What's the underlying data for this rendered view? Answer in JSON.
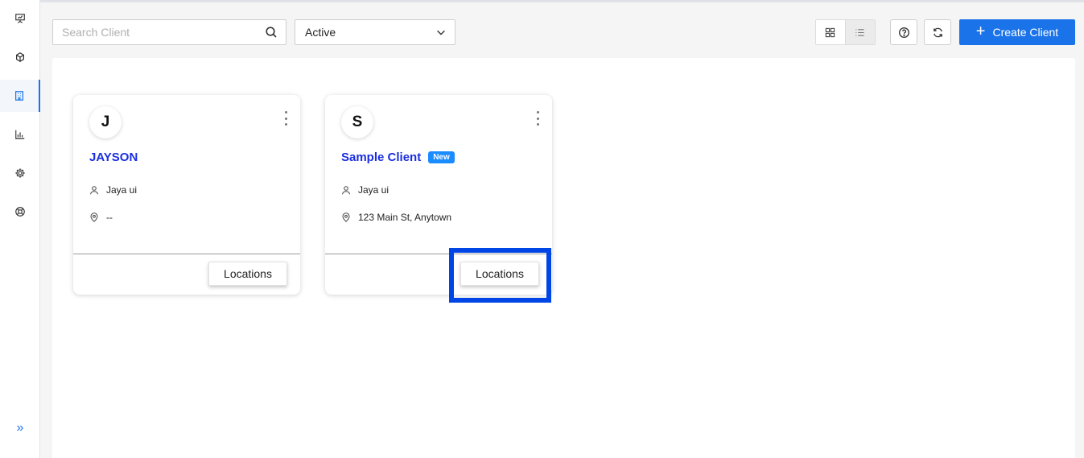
{
  "sidebar": {
    "items": [
      {
        "icon": "presentation-icon"
      },
      {
        "icon": "cube-icon"
      },
      {
        "icon": "building-icon",
        "active": true
      },
      {
        "icon": "bar-chart-icon"
      },
      {
        "icon": "gear-icon"
      },
      {
        "icon": "lifebuoy-icon"
      }
    ],
    "expand_icon": "»"
  },
  "toolbar": {
    "search_placeholder": "Search Client",
    "status_selected": "Active",
    "create_label": "Create Client",
    "create_plus": "+"
  },
  "clients": [
    {
      "initial": "J",
      "name": "JAYSON",
      "badge": "",
      "owner": "Jaya ui",
      "address": "--",
      "action_label": "Locations"
    },
    {
      "initial": "S",
      "name": "Sample Client",
      "badge": "New",
      "owner": "Jaya ui",
      "address": "123 Main St, Anytown",
      "action_label": "Locations"
    }
  ],
  "colors": {
    "accent": "#1a73e8",
    "client_name": "#1a2ee0",
    "badge": "#1a8cff",
    "highlight": "#0045e6"
  }
}
